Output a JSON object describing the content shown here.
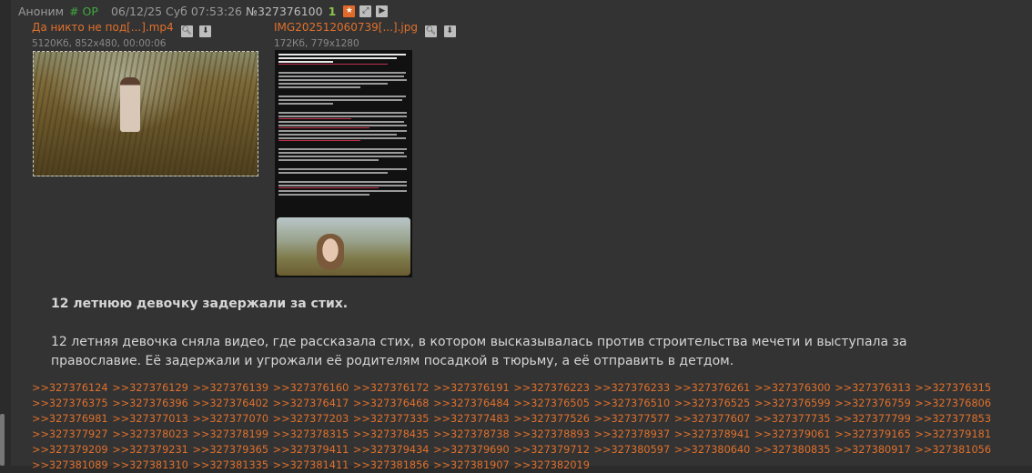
{
  "header": {
    "name": "Аноним",
    "op": "# OP",
    "date": "06/12/25 Суб 07:53:26",
    "num": "№327376100",
    "count": "1"
  },
  "files": [
    {
      "name": "Да никто не под[...].mp4",
      "meta": "5120Кб, 852x480, 00:00:06"
    },
    {
      "name": "IMG202512060739[...].jpg",
      "meta": "172Кб, 779x1280"
    }
  ],
  "subject": "12 летнюю девочку задержали за стих.",
  "body": "12 летняя девочка сняла видео, где рассказала стих, в котором высказывалась против строительства мечети и выступала за православие. Её задержали и угрожали её родителям посадкой в тюрьму, а её отправить в детдом.",
  "replies": [
    ">>327376124",
    ">>327376129",
    ">>327376139",
    ">>327376160",
    ">>327376172",
    ">>327376191",
    ">>327376223",
    ">>327376233",
    ">>327376261",
    ">>327376300",
    ">>327376313",
    ">>327376315",
    ">>327376375",
    ">>327376396",
    ">>327376402",
    ">>327376417",
    ">>327376468",
    ">>327376484",
    ">>327376505",
    ">>327376510",
    ">>327376525",
    ">>327376599",
    ">>327376759",
    ">>327376806",
    ">>327376981",
    ">>327377013",
    ">>327377070",
    ">>327377203",
    ">>327377335",
    ">>327377483",
    ">>327377526",
    ">>327377577",
    ">>327377607",
    ">>327377735",
    ">>327377799",
    ">>327377853",
    ">>327377927",
    ">>327378023",
    ">>327378199",
    ">>327378315",
    ">>327378435",
    ">>327378738",
    ">>327378893",
    ">>327378937",
    ">>327378941",
    ">>327379061",
    ">>327379165",
    ">>327379181",
    ">>327379209",
    ">>327379231",
    ">>327379365",
    ">>327379411",
    ">>327379434",
    ">>327379690",
    ">>327379712",
    ">>327380597",
    ">>327380640",
    ">>327380835",
    ">>327380917",
    ">>327381056",
    ">>327381089",
    ">>327381310",
    ">>327381335",
    ">>327381411",
    ">>327381856",
    ">>327381907",
    ">>327382019"
  ],
  "icons": {
    "star": "star-icon",
    "expand": "expand-icon",
    "play": "play-icon",
    "search": "search-icon",
    "download": "download-icon"
  },
  "colors": {
    "link": "#e0702b",
    "op": "#3fa93f",
    "count": "#8bc34a",
    "background": "#333333"
  }
}
